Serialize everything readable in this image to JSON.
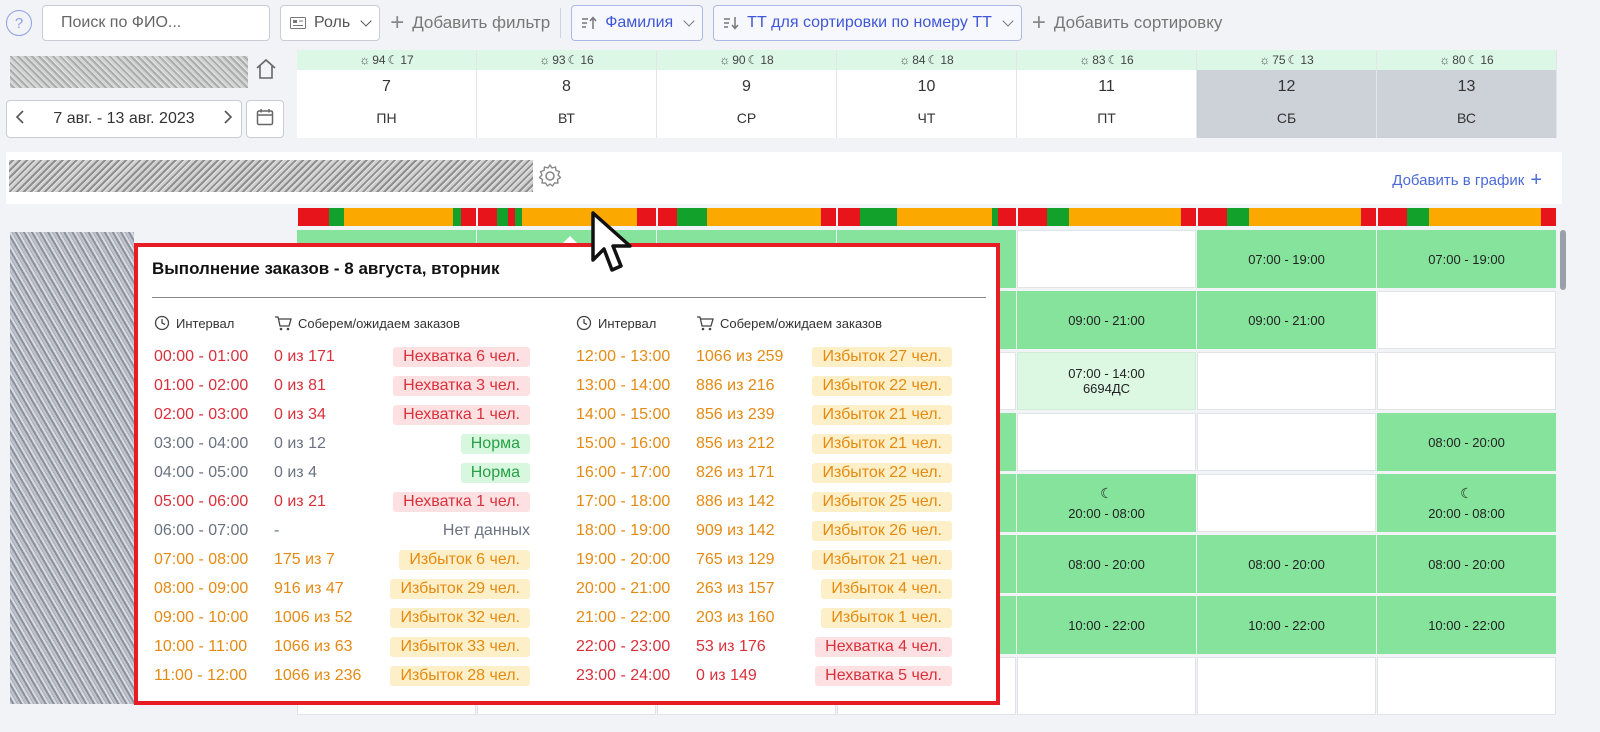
{
  "toolbar": {
    "help_icon": "?",
    "search_placeholder": "Поиск по ФИО...",
    "role_label": "Роль",
    "add_filter_label": "Добавить фильтр",
    "sort_surname_label": "Фамилия",
    "sort_tt_label": "ТТ для сортировки по номеру ТТ",
    "add_sort_label": "Добавить сортировку"
  },
  "period": {
    "range_label": "7 авг. - 13 авг. 2023"
  },
  "days": [
    {
      "num": "7",
      "name": "ПН",
      "sun": "94",
      "moon": "17",
      "weekend": false
    },
    {
      "num": "8",
      "name": "ВТ",
      "sun": "93",
      "moon": "16",
      "weekend": false
    },
    {
      "num": "9",
      "name": "СР",
      "sun": "90",
      "moon": "18",
      "weekend": false
    },
    {
      "num": "10",
      "name": "ЧТ",
      "sun": "84",
      "moon": "18",
      "weekend": false
    },
    {
      "num": "11",
      "name": "ПТ",
      "sun": "83",
      "moon": "16",
      "weekend": false
    },
    {
      "num": "12",
      "name": "СБ",
      "sun": "75",
      "moon": "13",
      "weekend": true
    },
    {
      "num": "13",
      "name": "ВС",
      "sun": "80",
      "moon": "16",
      "weekend": true
    }
  ],
  "group": {
    "add_to_schedule_label": "Добавить в график"
  },
  "colors": {
    "red": "#e8141c",
    "green": "#12a12a",
    "orange": "#fba900",
    "shift_green": "#86e39c",
    "accent_blue": "#3f57d4",
    "popup_border": "#e81c24"
  },
  "load_bars": [
    [
      "r",
      2,
      "g",
      1,
      "o",
      7,
      "g",
      0.5,
      "r",
      1
    ],
    [
      "r",
      1,
      "g",
      0.6,
      "r",
      0.4,
      "g",
      0.4,
      "o",
      6.2,
      "r",
      1
    ],
    [
      "r",
      1,
      "g",
      1.6,
      "o",
      6,
      "r",
      0.8
    ],
    [
      "r",
      1.2,
      "g",
      2,
      "o",
      5.2,
      "g",
      0.3,
      "r",
      1
    ],
    [
      "r",
      1.6,
      "g",
      1.2,
      "o",
      6.2,
      "r",
      0.8
    ],
    [
      "r",
      1.6,
      "g",
      1.2,
      "o",
      6.2,
      "r",
      0.8
    ],
    [
      "r",
      1.6,
      "g",
      1.2,
      "o",
      6.2,
      "r",
      0.8
    ]
  ],
  "grid_rows": [
    [
      {
        "s": "g",
        "t": ""
      },
      {
        "s": "g",
        "t": ""
      },
      {
        "s": "g",
        "t": ""
      },
      {
        "s": "g",
        "t": ""
      },
      {
        "s": "w",
        "t": ""
      },
      {
        "s": "g",
        "t": "07:00 - 19:00"
      },
      {
        "s": "g",
        "t": "07:00 - 19:00"
      }
    ],
    [
      {
        "s": "g",
        "t": ""
      },
      {
        "s": "g",
        "t": ""
      },
      {
        "s": "g",
        "t": ""
      },
      {
        "s": "g",
        "t": ""
      },
      {
        "s": "g",
        "t": "09:00 - 21:00"
      },
      {
        "s": "g",
        "t": "09:00 - 21:00"
      },
      {
        "s": "w",
        "t": ""
      }
    ],
    [
      {
        "s": "w",
        "t": ""
      },
      {
        "s": "w",
        "t": ""
      },
      {
        "s": "w",
        "t": ""
      },
      {
        "s": "w",
        "t": ""
      },
      {
        "s": "lg",
        "t": "07:00 - 14:00",
        "t2": "6694ДС"
      },
      {
        "s": "w",
        "t": ""
      },
      {
        "s": "w",
        "t": ""
      }
    ],
    [
      {
        "s": "g",
        "t": ""
      },
      {
        "s": "g",
        "t": ""
      },
      {
        "s": "g",
        "t": ""
      },
      {
        "s": "g",
        "t": ""
      },
      {
        "s": "w",
        "t": ""
      },
      {
        "s": "w",
        "t": ""
      },
      {
        "s": "g",
        "t": "08:00 - 20:00"
      }
    ],
    [
      {
        "s": "g",
        "t": ""
      },
      {
        "s": "g",
        "t": ""
      },
      {
        "s": "g",
        "t": ""
      },
      {
        "s": "g",
        "t": ""
      },
      {
        "s": "g",
        "t": "20:00 - 08:00",
        "moon": true
      },
      {
        "s": "w",
        "t": ""
      },
      {
        "s": "g",
        "t": "20:00 - 08:00",
        "moon": true
      }
    ],
    [
      {
        "s": "g",
        "t": ""
      },
      {
        "s": "g",
        "t": ""
      },
      {
        "s": "g",
        "t": ""
      },
      {
        "s": "g",
        "t": ""
      },
      {
        "s": "g",
        "t": "08:00 - 20:00"
      },
      {
        "s": "g",
        "t": "08:00 - 20:00"
      },
      {
        "s": "g",
        "t": "08:00 - 20:00"
      }
    ],
    [
      {
        "s": "g",
        "t": ""
      },
      {
        "s": "g",
        "t": ""
      },
      {
        "s": "g",
        "t": ""
      },
      {
        "s": "g",
        "t": ""
      },
      {
        "s": "g",
        "t": "10:00 - 22:00"
      },
      {
        "s": "g",
        "t": "10:00 - 22:00"
      },
      {
        "s": "g",
        "t": "10:00 - 22:00"
      }
    ],
    [
      {
        "s": "w",
        "t": ""
      },
      {
        "s": "w",
        "t": ""
      },
      {
        "s": "w",
        "t": ""
      },
      {
        "s": "w",
        "t": ""
      },
      {
        "s": "w",
        "t": ""
      },
      {
        "s": "w",
        "t": ""
      },
      {
        "s": "w",
        "t": ""
      }
    ]
  ],
  "popup": {
    "title": "Выполнение заказов - 8 августа, вторник",
    "col_interval": "Интервал",
    "col_orders": "Соберем/ожидаем заказов",
    "left_rows": [
      {
        "time": "00:00 - 01:00",
        "val": "0 из 171",
        "status": "Нехватка 6 чел.",
        "kind": "red"
      },
      {
        "time": "01:00 - 02:00",
        "val": "0 из 81",
        "status": "Нехватка 3 чел.",
        "kind": "red"
      },
      {
        "time": "02:00 - 03:00",
        "val": "0 из 34",
        "status": "Нехватка 1 чел.",
        "kind": "red"
      },
      {
        "time": "03:00 - 04:00",
        "val": "0 из 12",
        "status": "Норма",
        "kind": "green"
      },
      {
        "time": "04:00 - 05:00",
        "val": "0 из 4",
        "status": "Норма",
        "kind": "green"
      },
      {
        "time": "05:00 - 06:00",
        "val": "0 из 21",
        "status": "Нехватка 1 чел.",
        "kind": "red"
      },
      {
        "time": "06:00 - 07:00",
        "val": "-",
        "status": "Нет данных",
        "kind": "none"
      },
      {
        "time": "07:00 - 08:00",
        "val": "175 из 7",
        "status": "Избыток 6 чел.",
        "kind": "orange"
      },
      {
        "time": "08:00 - 09:00",
        "val": "916 из 47",
        "status": "Избыток 29 чел.",
        "kind": "orange"
      },
      {
        "time": "09:00 - 10:00",
        "val": "1006 из 52",
        "status": "Избыток 32 чел.",
        "kind": "orange"
      },
      {
        "time": "10:00 - 11:00",
        "val": "1066 из 63",
        "status": "Избыток 33 чел.",
        "kind": "orange"
      },
      {
        "time": "11:00 - 12:00",
        "val": "1066 из 236",
        "status": "Избыток 28 чел.",
        "kind": "orange"
      }
    ],
    "right_rows": [
      {
        "time": "12:00 - 13:00",
        "val": "1066 из 259",
        "status": "Избыток 27 чел.",
        "kind": "orange"
      },
      {
        "time": "13:00 - 14:00",
        "val": "886 из 216",
        "status": "Избыток 22 чел.",
        "kind": "orange"
      },
      {
        "time": "14:00 - 15:00",
        "val": "856 из 239",
        "status": "Избыток 21 чел.",
        "kind": "orange"
      },
      {
        "time": "15:00 - 16:00",
        "val": "856 из 212",
        "status": "Избыток 21 чел.",
        "kind": "orange"
      },
      {
        "time": "16:00 - 17:00",
        "val": "826 из 171",
        "status": "Избыток 22 чел.",
        "kind": "orange"
      },
      {
        "time": "17:00 - 18:00",
        "val": "886 из 142",
        "status": "Избыток 25 чел.",
        "kind": "orange"
      },
      {
        "time": "18:00 - 19:00",
        "val": "909 из 142",
        "status": "Избыток 26 чел.",
        "kind": "orange"
      },
      {
        "time": "19:00 - 20:00",
        "val": "765 из 129",
        "status": "Избыток 21 чел.",
        "kind": "orange"
      },
      {
        "time": "20:00 - 21:00",
        "val": "263 из 157",
        "status": "Избыток 4 чел.",
        "kind": "orange"
      },
      {
        "time": "21:00 - 22:00",
        "val": "203 из 160",
        "status": "Избыток 1 чел.",
        "kind": "orange"
      },
      {
        "time": "22:00 - 23:00",
        "val": "53 из 176",
        "status": "Нехватка 4 чел.",
        "kind": "red"
      },
      {
        "time": "23:00 - 24:00",
        "val": "0 из 149",
        "status": "Нехватка 5 чел.",
        "kind": "red"
      }
    ]
  }
}
